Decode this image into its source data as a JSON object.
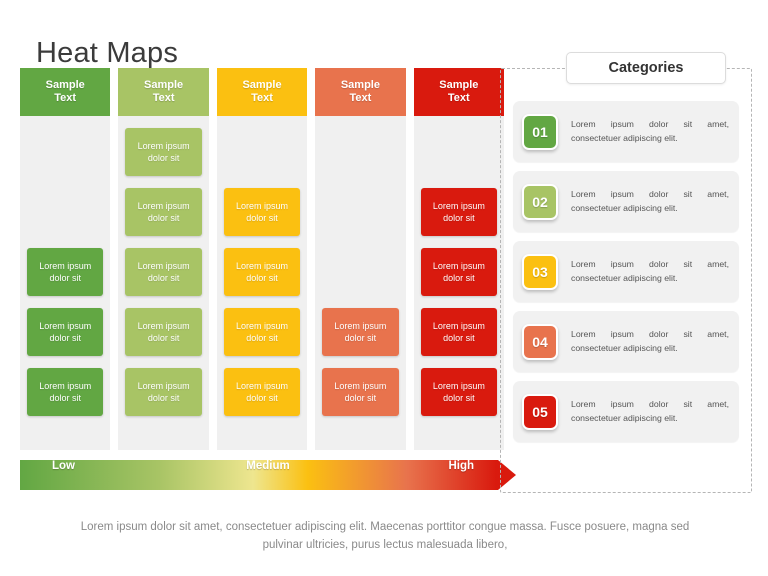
{
  "page_title": "Heat Maps",
  "colors": {
    "col1": "#62a743",
    "col2": "#a8c465",
    "col3": "#fbc011",
    "col4": "#e8734d",
    "col5": "#d91a0e",
    "band": "#f0f0f0",
    "gradient": "linear-gradient(to right, #62a743 0%, #a8c465 28%, #eee68f 47%, #fbc011 58%, #e8734d 78%, #d91a0e 96%)"
  },
  "heatmap": {
    "columns": [
      {
        "header": "Sample\nText",
        "header_line1": "Sample",
        "header_line2": "Text",
        "color_key": "col1"
      },
      {
        "header": "Sample\nText",
        "header_line1": "Sample",
        "header_line2": "Text",
        "color_key": "col2"
      },
      {
        "header": "Sample\nText",
        "header_line1": "Sample",
        "header_line2": "Text",
        "color_key": "col3"
      },
      {
        "header": "Sample\nText",
        "header_line1": "Sample",
        "header_line2": "Text",
        "color_key": "col4"
      },
      {
        "header": "Sample\nText",
        "header_line1": "Sample",
        "header_line2": "Text",
        "color_key": "col5"
      }
    ],
    "cell_text_line1": "Lorem ipsum",
    "cell_text_line2": "dolor sit",
    "rows": [
      {
        "cells": [
          false,
          true,
          false,
          false,
          false
        ]
      },
      {
        "cells": [
          false,
          true,
          true,
          false,
          true
        ]
      },
      {
        "cells": [
          true,
          true,
          true,
          false,
          true
        ]
      },
      {
        "cells": [
          true,
          true,
          true,
          true,
          true
        ]
      },
      {
        "cells": [
          true,
          true,
          true,
          true,
          true
        ]
      }
    ]
  },
  "legend": {
    "low": "Low",
    "medium": "Medium",
    "high": "High"
  },
  "categories": {
    "title": "Categories",
    "items": [
      {
        "number": "01",
        "color_key": "col1",
        "text": "Lorem ipsum dolor sit amet, consectetuer adipiscing elit."
      },
      {
        "number": "02",
        "color_key": "col2",
        "text": "Lorem ipsum dolor sit amet, consectetuer adipiscing elit."
      },
      {
        "number": "03",
        "color_key": "col3",
        "text": "Lorem ipsum dolor sit amet, consectetuer adipiscing elit."
      },
      {
        "number": "04",
        "color_key": "col4",
        "text": "Lorem ipsum dolor sit amet, consectetuer adipiscing elit."
      },
      {
        "number": "05",
        "color_key": "col5",
        "text": "Lorem ipsum dolor sit amet, consectetuer adipiscing elit."
      }
    ]
  },
  "caption": "Lorem ipsum dolor sit amet, consectetuer adipiscing elit. Maecenas porttitor congue massa. Fusce posuere, magna sed pulvinar ultricies, purus lectus malesuada libero,"
}
